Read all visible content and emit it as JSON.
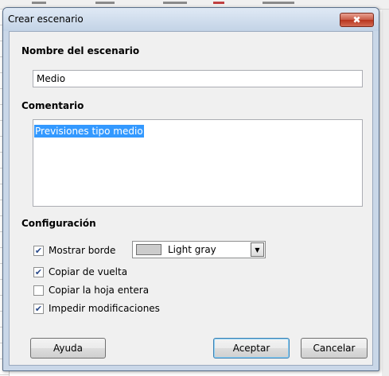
{
  "dialog": {
    "title": "Crear escenario",
    "close_glyph": "✖"
  },
  "scenario_name": {
    "heading": "Nombre del escenario",
    "value": "Medio"
  },
  "comment": {
    "heading": "Comentario",
    "value": "Previsiones tipo medio"
  },
  "settings": {
    "heading": "Configuración",
    "show_border": {
      "label": "Mostrar borde",
      "checked": true
    },
    "border_color": {
      "value": "Light gray",
      "swatch_color": "#cccccc"
    },
    "copy_back": {
      "label": "Copiar de vuelta",
      "checked": true
    },
    "copy_entire_sheet": {
      "label": "Copiar la hoja entera",
      "checked": false
    },
    "prevent_changes": {
      "label": "Impedir modificaciones",
      "checked": true
    }
  },
  "buttons": {
    "help": "Ayuda",
    "ok": "Aceptar",
    "cancel": "Cancelar"
  },
  "colors": {
    "selection": "#3399ff",
    "dialog_frame": "#c9d7e8",
    "close_button": "#c75a45"
  }
}
